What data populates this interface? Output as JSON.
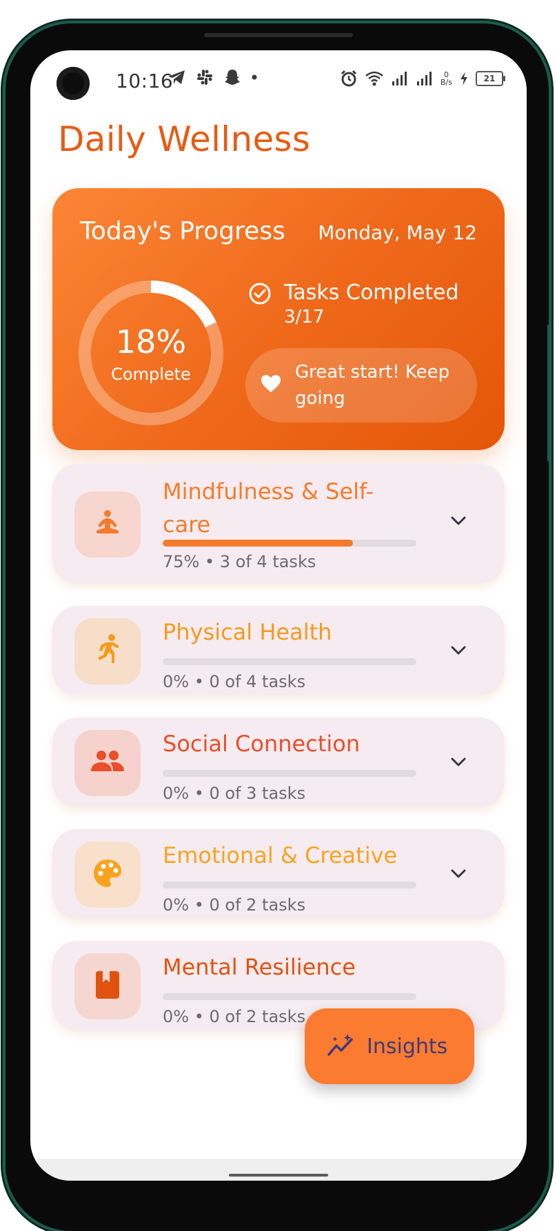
{
  "status_bar": {
    "time": "10:16",
    "net_speed_value": "0",
    "net_speed_unit": "B/s",
    "battery": "21"
  },
  "page": {
    "title": "Daily Wellness"
  },
  "progress_card": {
    "title": "Today's Progress",
    "date": "Monday, May 12",
    "percent": 18,
    "percent_text": "18%",
    "percent_label": "Complete",
    "tasks_label": "Tasks Completed",
    "tasks_count": "3/17",
    "motivation": "Great start! Keep going",
    "colors": {
      "gradient_start": "#fb8635",
      "gradient_end": "#e55608"
    }
  },
  "categories": [
    {
      "title": "Mindfulness & Self-care",
      "icon": "meditation-icon",
      "progress": 0.75,
      "meta": "75% • 3 of 4 tasks",
      "color": "#f47b2c",
      "icon_bg": "#f7d6cf",
      "title_line1": "Mindfulness & Self-",
      "title_line2": "care"
    },
    {
      "title": "Physical Health",
      "icon": "running-icon",
      "progress": 0,
      "meta": "0% • 0 of 4 tasks",
      "color": "#f59a1e",
      "icon_bg": "#f7dec9"
    },
    {
      "title": "Social Connection",
      "icon": "people-icon",
      "progress": 0,
      "meta": "0% • 0 of 3 tasks",
      "color": "#ea4e2a",
      "icon_bg": "#f6d2cd"
    },
    {
      "title": "Emotional & Creative",
      "icon": "palette-icon",
      "progress": 0,
      "meta": "0% • 0 of 2 tasks",
      "color": "#f8a320",
      "icon_bg": "#f8e0cd"
    },
    {
      "title": "Mental Resilience",
      "icon": "book-icon",
      "progress": 0,
      "meta": "0% • 0 of 2 tasks",
      "color": "#e2520f",
      "icon_bg": "#f6d6d0"
    }
  ],
  "fab": {
    "label": "Insights",
    "icon": "auto-graph-icon",
    "color": "#fb7b31"
  }
}
